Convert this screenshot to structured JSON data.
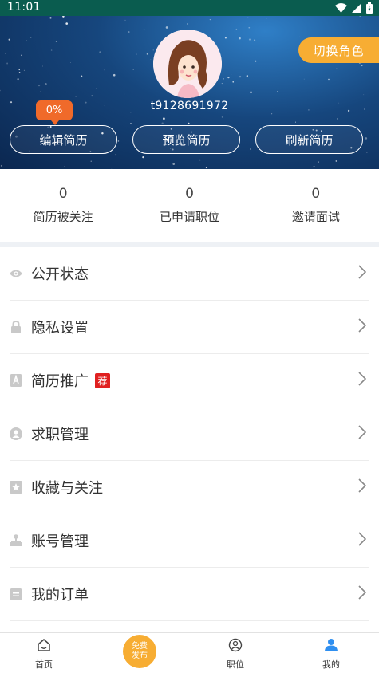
{
  "status_bar": {
    "time": "11:01"
  },
  "header": {
    "switch_role": "切换角色",
    "username": "t9128691972",
    "resume_progress": "0%",
    "buttons": {
      "edit": "编辑简历",
      "preview": "预览简历",
      "refresh": "刷新简历"
    }
  },
  "stats": [
    {
      "value": "0",
      "label": "简历被关注"
    },
    {
      "value": "0",
      "label": "已申请职位"
    },
    {
      "value": "0",
      "label": "邀请面试"
    }
  ],
  "menu": [
    {
      "label": "公开状态",
      "icon": "eye-icon"
    },
    {
      "label": "隐私设置",
      "icon": "lock-icon"
    },
    {
      "label": "简历推广",
      "icon": "promote-icon",
      "tag": "荐"
    },
    {
      "label": "求职管理",
      "icon": "job-manage-icon"
    },
    {
      "label": "收藏与关注",
      "icon": "favorite-icon"
    },
    {
      "label": "账号管理",
      "icon": "account-icon"
    },
    {
      "label": "我的订单",
      "icon": "order-icon"
    }
  ],
  "bottom_nav": {
    "home": "首页",
    "publish_line1": "免费",
    "publish_line2": "发布",
    "jobs": "职位",
    "mine": "我的"
  },
  "colors": {
    "accent": "#f7ad33",
    "badge": "#f06a2a",
    "status_bar": "#0a5c4f",
    "active_nav": "#2f8ff0",
    "tag": "#e02020"
  }
}
